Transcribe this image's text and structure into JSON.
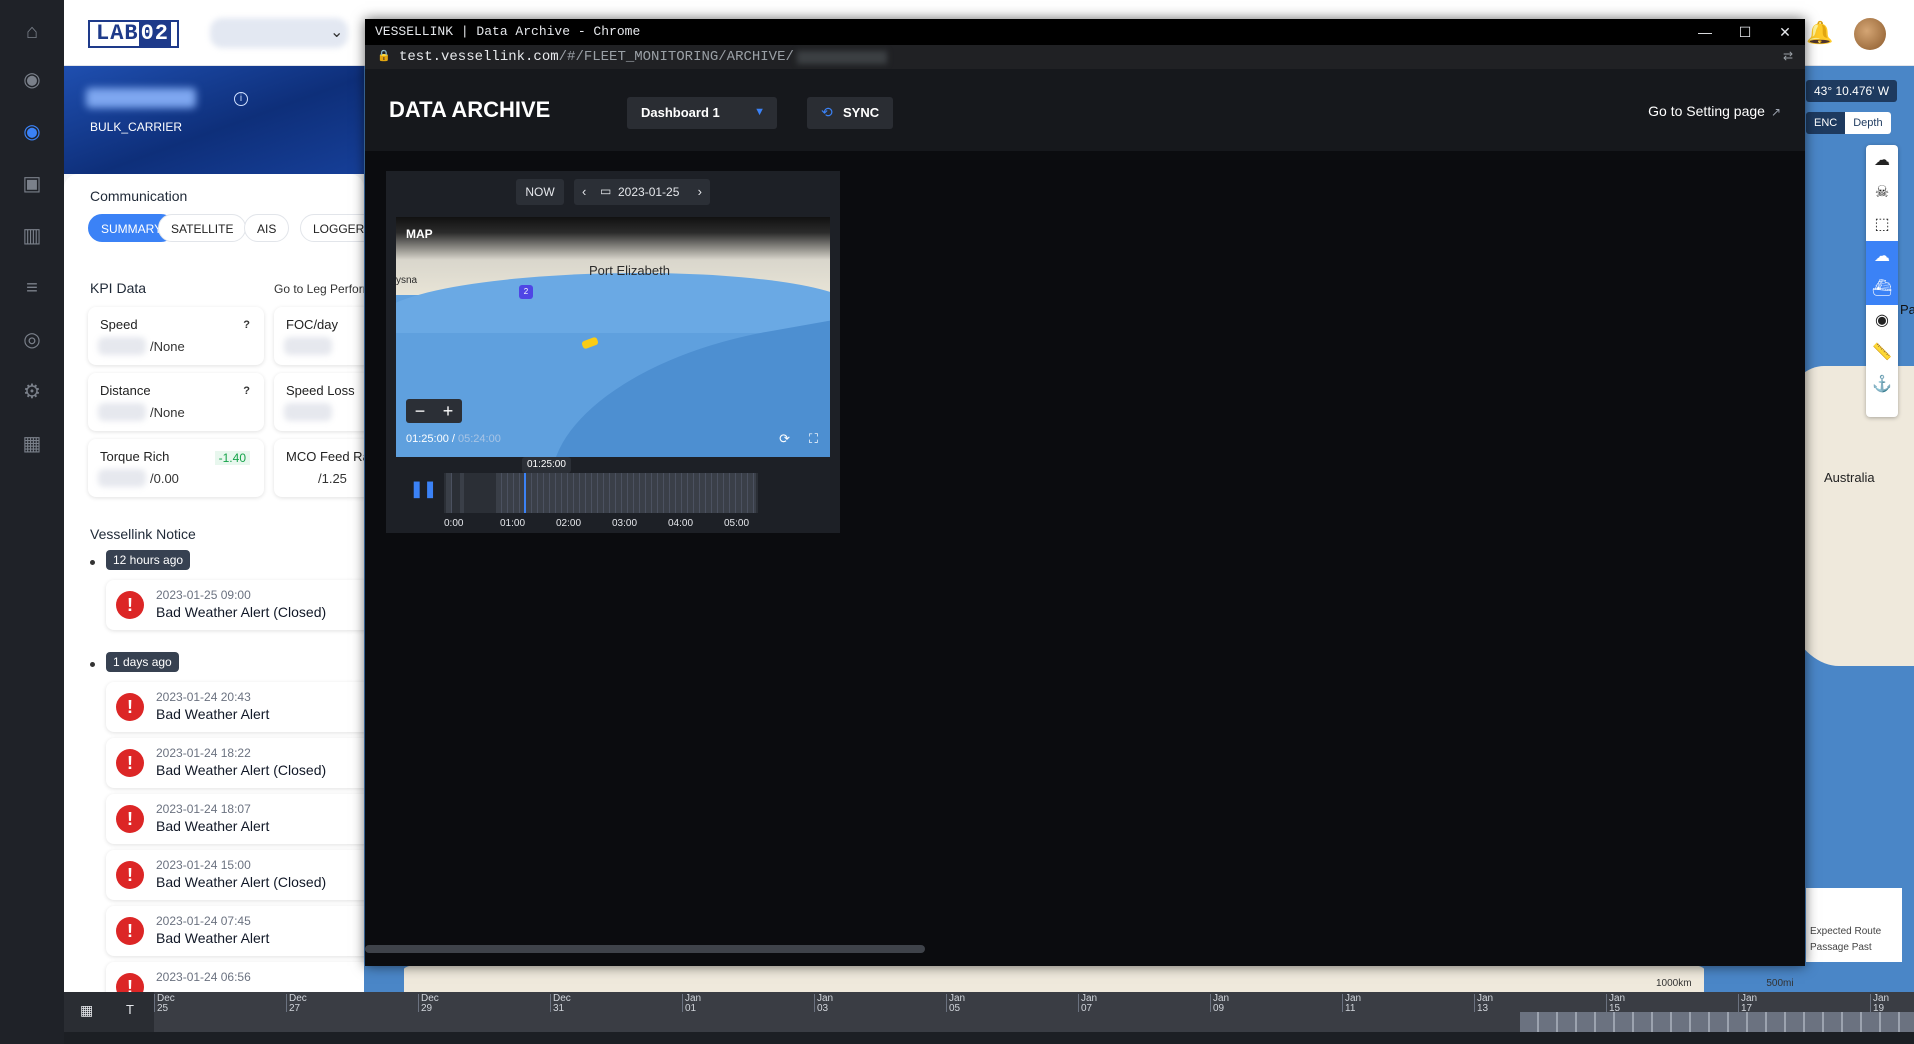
{
  "app": {
    "logo": {
      "prefix": "LAB",
      "suffix": "02"
    },
    "vessel": {
      "type": "BULK_CARRIER"
    },
    "communication": {
      "title": "Communication",
      "tabs": [
        "SUMMARY",
        "SATELLITE",
        "AIS",
        "LOGGER"
      ],
      "active_tab": "SUMMARY"
    },
    "kpi": {
      "title": "KPI Data",
      "link": "Go to Leg Perform",
      "cards": [
        {
          "label": "Speed",
          "hint": "?",
          "value": "/None"
        },
        {
          "label": "FOC/day",
          "hint": "",
          "value": ""
        },
        {
          "label": "Distance",
          "hint": "?",
          "value": "/None"
        },
        {
          "label": "Speed Loss",
          "hint": "",
          "value": ""
        },
        {
          "label": "Torque Rich",
          "hint": "-1.40",
          "value": "/0.00"
        },
        {
          "label": "MCO Feed Rat",
          "hint": "",
          "value": "/1.25"
        }
      ]
    },
    "notice": {
      "title": "Vessellink Notice",
      "groups": [
        {
          "badge": "12 hours ago",
          "items": [
            {
              "time": "2023-01-25 09:00",
              "message": "Bad Weather Alert (Closed)"
            }
          ]
        },
        {
          "badge": "1 days ago",
          "items": [
            {
              "time": "2023-01-24 20:43",
              "message": "Bad Weather Alert"
            },
            {
              "time": "2023-01-24 18:22",
              "message": "Bad Weather Alert (Closed)"
            },
            {
              "time": "2023-01-24 18:07",
              "message": "Bad Weather Alert"
            },
            {
              "time": "2023-01-24 15:00",
              "message": "Bad Weather Alert (Closed)"
            },
            {
              "time": "2023-01-24 07:45",
              "message": "Bad Weather Alert"
            },
            {
              "time": "2023-01-24 06:56",
              "message": ""
            }
          ]
        }
      ]
    },
    "map": {
      "coordinate": "43° 10.476' W",
      "layers": [
        "ENC",
        "Depth"
      ],
      "labels": {
        "australia": "Australia",
        "pa": "Pa"
      },
      "legend": [
        "Expected Route",
        "Passage Past"
      ],
      "scale": [
        "1000km",
        "500mi"
      ]
    },
    "timeline": {
      "toggle": "T",
      "labels": [
        {
          "month": "Dec",
          "day": "25"
        },
        {
          "month": "Dec",
          "day": "27"
        },
        {
          "month": "Dec",
          "day": "29"
        },
        {
          "month": "Dec",
          "day": "31"
        },
        {
          "month": "Jan",
          "day": "01"
        },
        {
          "month": "Jan",
          "day": "03"
        },
        {
          "month": "Jan",
          "day": "05"
        },
        {
          "month": "Jan",
          "day": "07"
        },
        {
          "month": "Jan",
          "day": "09"
        },
        {
          "month": "Jan",
          "day": "11"
        },
        {
          "month": "Jan",
          "day": "13"
        },
        {
          "month": "Jan",
          "day": "15"
        },
        {
          "month": "Jan",
          "day": "17"
        },
        {
          "month": "Jan",
          "day": "19"
        }
      ]
    }
  },
  "popup": {
    "window_title": "VESSELLINK | Data Archive - Chrome",
    "url": {
      "host": "test.vessellink.com",
      "path": "/#/FLEET_MONITORING/ARCHIVE/"
    },
    "header": {
      "title": "DATA ARCHIVE",
      "dashboard_select": "Dashboard 1",
      "sync_label": "SYNC",
      "settings_link": "Go to Setting page"
    },
    "widget": {
      "now_label": "NOW",
      "date": "2023-01-25",
      "map_label": "MAP",
      "places": {
        "city": "Port Elizabeth",
        "town_fragment": "ysna",
        "route": "2"
      },
      "current_time": "01:25:00",
      "separator": "/",
      "duration": "05:24:00",
      "tooltip": "01:25:00",
      "ticks": [
        "0:00",
        "01:00",
        "02:00",
        "03:00",
        "04:00",
        "05:00"
      ]
    }
  }
}
